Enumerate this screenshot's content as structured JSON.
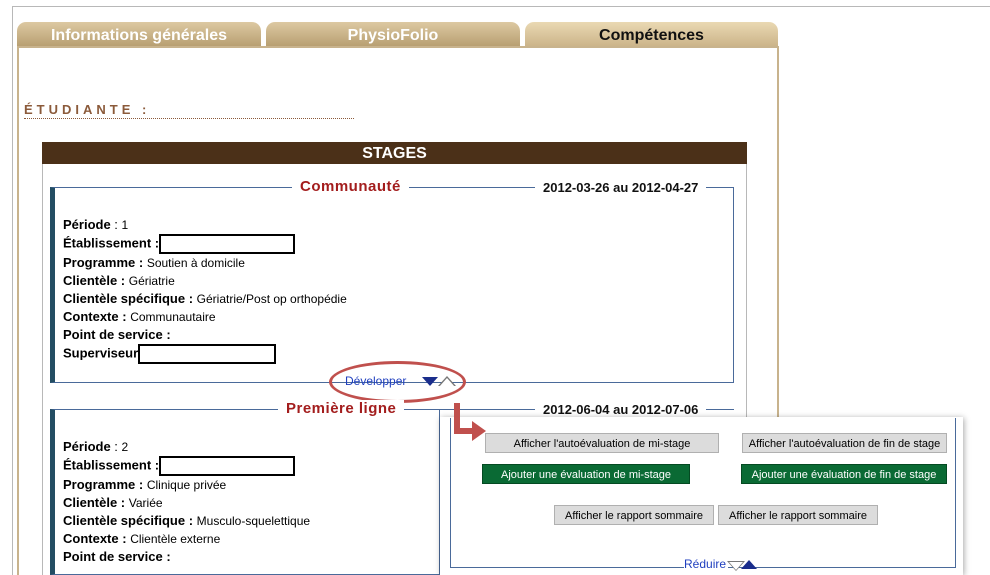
{
  "tabs": [
    {
      "label": "Informations générales"
    },
    {
      "label": "PhysioFolio"
    },
    {
      "label": "Compétences"
    }
  ],
  "student_label": "ÉTUDIANTE :",
  "stages_title": "STAGES",
  "stages": [
    {
      "title": "Communauté",
      "dates": "2012-03-26 au 2012-04-27",
      "periode_label": "Période",
      "periode_value": "1",
      "etablissement_label": "Établissement :",
      "programme_label": "Programme :",
      "programme_value": "Soutien à domicile",
      "clientele_label": "Clientèle :",
      "clientele_value": "Gériatrie",
      "clientele_spec_label": "Clientèle spécifique :",
      "clientele_spec_value": "Gériatrie/Post op orthopédie",
      "contexte_label": "Contexte :",
      "contexte_value": "Communautaire",
      "point_service_label": "Point de service :",
      "superviseur_label": "Superviseur",
      "expand_label": "Développer"
    },
    {
      "title": "Première ligne",
      "dates": "2012-06-04 au 2012-07-06",
      "periode_label": "Période",
      "periode_value": "2",
      "etablissement_label": "Établissement :",
      "programme_label": "Programme :",
      "programme_value": "Clinique privée",
      "clientele_label": "Clientèle :",
      "clientele_value": "Variée",
      "clientele_spec_label": "Clientèle spécifique :",
      "clientele_spec_value": "Musculo-squelettique",
      "contexte_label": "Contexte :",
      "contexte_value": "Clientèle externe",
      "point_service_label": "Point de service :"
    }
  ],
  "panel": {
    "btn_show_mid": "Afficher l'autoévaluation de mi-stage",
    "btn_show_end": "Afficher l'autoévaluation de fin de stage",
    "btn_add_mid": "Ajouter une évaluation de mi-stage",
    "btn_add_end": "Ajouter une évaluation de fin de stage",
    "btn_report_1": "Afficher le rapport sommaire",
    "btn_report_2": "Afficher le rapport sommaire",
    "reduce_label": "Réduire"
  },
  "colors": {
    "tab_brown": "#b59c6e",
    "header_dark_brown": "#4b3018",
    "legend_red": "#a31d1d",
    "link_blue": "#1f3fbf",
    "green_button": "#0a6a34",
    "annotation_red": "#c0504d"
  }
}
